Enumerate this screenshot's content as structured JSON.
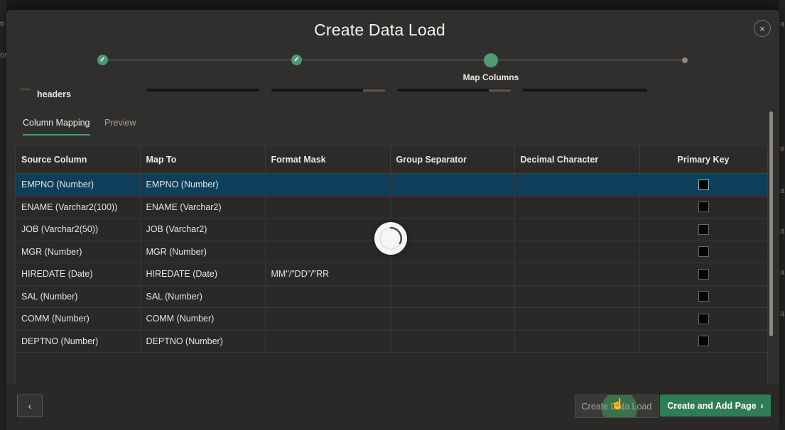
{
  "background": {
    "left_fragments": [
      "ti",
      "on"
    ],
    "right_fragments": [
      "a",
      "e",
      "a",
      "a",
      "a",
      "a"
    ]
  },
  "dialog": {
    "title": "Create Data Load",
    "close_icon": "×"
  },
  "wizard": {
    "done_icon": "✓",
    "current_label": "Map Columns"
  },
  "underlay": {
    "headers_label": "headers"
  },
  "tabs": [
    {
      "label": "Column Mapping",
      "active": true
    },
    {
      "label": "Preview",
      "active": false
    }
  ],
  "table": {
    "columns": [
      "Source Column",
      "Map To",
      "Format Mask",
      "Group Separator",
      "Decimal Character",
      "Primary Key"
    ],
    "rows": [
      {
        "source": "EMPNO (Number)",
        "map_to": "EMPNO (Number)",
        "format_mask": "",
        "group_separator": "",
        "decimal_character": ""
      },
      {
        "source": "ENAME (Varchar2(100))",
        "map_to": "ENAME (Varchar2)",
        "format_mask": "",
        "group_separator": "",
        "decimal_character": ""
      },
      {
        "source": "JOB (Varchar2(50))",
        "map_to": "JOB (Varchar2)",
        "format_mask": "",
        "group_separator": "",
        "decimal_character": ""
      },
      {
        "source": "MGR (Number)",
        "map_to": "MGR (Number)",
        "format_mask": "",
        "group_separator": "",
        "decimal_character": ""
      },
      {
        "source": "HIREDATE (Date)",
        "map_to": "HIREDATE (Date)",
        "format_mask": "MM\"/\"DD\"/\"RR",
        "group_separator": "",
        "decimal_character": ""
      },
      {
        "source": "SAL (Number)",
        "map_to": "SAL (Number)",
        "format_mask": "",
        "group_separator": "",
        "decimal_character": ""
      },
      {
        "source": "COMM (Number)",
        "map_to": "COMM (Number)",
        "format_mask": "",
        "group_separator": "",
        "decimal_character": ""
      },
      {
        "source": "DEPTNO (Number)",
        "map_to": "DEPTNO (Number)",
        "format_mask": "",
        "group_separator": "",
        "decimal_character": ""
      }
    ]
  },
  "footer": {
    "back_icon": "‹",
    "create_label": "Create Data Load",
    "create_add_label": "Create and Add Page",
    "create_add_icon": "›"
  },
  "colors": {
    "accent": "#4c9b72",
    "primary_button": "#2f7d57",
    "selected_row": "#0e3f5a",
    "dialog_bg": "#312f2d"
  }
}
